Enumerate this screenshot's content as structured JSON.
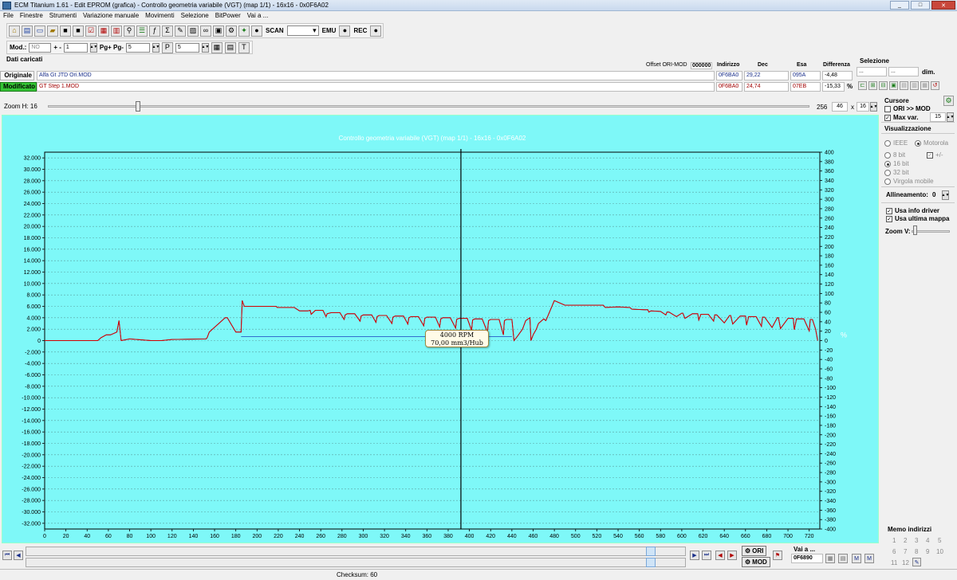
{
  "window": {
    "title": "ECM Titanium 1.61 - Edit EPROM (grafica) - Controllo geometria variabile (VGT) (map 1/1) - 16x16 - 0x0F6A02",
    "minimize": "_",
    "maximize": "□",
    "close": "✕"
  },
  "menu": [
    "File",
    "Finestre",
    "Strumenti",
    "Variazione manuale",
    "Movimenti",
    "Selezione",
    "BitPower",
    "Vai a ..."
  ],
  "toolbar": {
    "scan": "SCAN",
    "emu": "EMU",
    "rec": "REC",
    "sigma": "Σ"
  },
  "toolbar2": {
    "mod_label": "Mod.:",
    "mod_value": "NO",
    "plusminus_label": "+ -",
    "plusminus_value": "1",
    "pg_label": "Pg+ Pg-",
    "pg_value": "5",
    "p_value": "5"
  },
  "data_section": {
    "heading": "Dati caricati",
    "offset_label": "Offset ORI-MOD",
    "offset_value": "000000",
    "col_indirizzo": "Indirizzo",
    "col_dec": "Dec",
    "col_esa": "Esa",
    "col_diff": "Differenza",
    "selezione": "Selezione",
    "sel_from": "...",
    "sel_to": "...",
    "sel_dim_label": "dim.",
    "sel_dim_value": "...",
    "originale": {
      "tag": "Originale",
      "file": "Alfa Gt JTD Ori.MOD",
      "indirizzo": "0F6BA0",
      "dec": "29,22",
      "esa": "095A",
      "diff": "-4,48"
    },
    "modificato": {
      "tag": "Modificato",
      "file": "GT Step 1.MOD",
      "indirizzo": "0F6BA0",
      "dec": "24,74",
      "esa": "07EB",
      "diff": "-15,33",
      "pct": "%"
    }
  },
  "zoom": {
    "label": "Zoom H: 16",
    "v1": "256",
    "v2": "46",
    "x": "x",
    "v3": "16"
  },
  "cursor_tip": {
    "line1": "4000 RPM",
    "line2": "70,00 mm3/Hub"
  },
  "chart_data": {
    "type": "line",
    "title": "Controllo geometria variabile (VGT) (map 1/1) - 16x16 - 0x0F6A02",
    "xlabel": "",
    "ylabel": "",
    "y2label": "%",
    "xlim": [
      0,
      730
    ],
    "ylim": [
      -33000,
      33000
    ],
    "y2lim": [
      -400,
      400
    ],
    "xticks": [
      0,
      20,
      40,
      60,
      80,
      100,
      120,
      140,
      160,
      180,
      200,
      220,
      240,
      260,
      280,
      300,
      320,
      340,
      360,
      380,
      400,
      420,
      440,
      460,
      480,
      500,
      520,
      540,
      560,
      580,
      600,
      620,
      640,
      660,
      680,
      700,
      720
    ],
    "yticks": [
      32000,
      30000,
      28000,
      26000,
      24000,
      22000,
      20000,
      18000,
      16000,
      14000,
      12000,
      10000,
      8000,
      6000,
      4000,
      2000,
      0,
      -2000,
      -4000,
      -6000,
      -8000,
      -10000,
      -12000,
      -14000,
      -16000,
      -18000,
      -20000,
      -22000,
      -24000,
      -26000,
      -28000,
      -30000,
      -32000
    ],
    "yticklabels": [
      "32.000",
      "30.000",
      "28.000",
      "26.000",
      "24.000",
      "22.000",
      "20.000",
      "18.000",
      "16.000",
      "14.000",
      "12.000",
      "10.000",
      "8.000",
      "6.000",
      "4.000",
      "2.000",
      "0",
      "-2.000",
      "-4.000",
      "-6.000",
      "-8.000",
      "-10.000",
      "-12.000",
      "-14.000",
      "-16.000",
      "-18.000",
      "-20.000",
      "-22.000",
      "-24.000",
      "-26.000",
      "-28.000",
      "-30.000",
      "-32.000"
    ],
    "y2ticks": [
      400,
      380,
      360,
      340,
      320,
      300,
      280,
      260,
      240,
      220,
      200,
      180,
      160,
      140,
      120,
      100,
      80,
      60,
      40,
      20,
      0,
      -20,
      -40,
      -60,
      -80,
      -100,
      -120,
      -140,
      -160,
      -180,
      -200,
      -220,
      -240,
      -260,
      -280,
      -300,
      -320,
      -340,
      -360,
      -380,
      -400
    ],
    "cursor_x": 392,
    "grid": true,
    "series": [
      {
        "color": "#d40000",
        "x": [
          0,
          50,
          53,
          58,
          60,
          62,
          68,
          70,
          72,
          80,
          100,
          110,
          120,
          152,
          153,
          155,
          170,
          172,
          180,
          185,
          186,
          188,
          200,
          210,
          215,
          218,
          219,
          220,
          235,
          240,
          248,
          250,
          251,
          255,
          262,
          265,
          266,
          270,
          278,
          282,
          283,
          285,
          292,
          297,
          298,
          300,
          308,
          312,
          313,
          315,
          322,
          327,
          328,
          330,
          338,
          342,
          343,
          345,
          352,
          357,
          358,
          360,
          368,
          372,
          373,
          375,
          382,
          387,
          388,
          390,
          398,
          402,
          403,
          405,
          412,
          417,
          418,
          420,
          428,
          432,
          433,
          435,
          437,
          440,
          442,
          445,
          450,
          453,
          457,
          458,
          460,
          463,
          465,
          470,
          472,
          480,
          490,
          500,
          510,
          520,
          525,
          526,
          528,
          540,
          550,
          551,
          553,
          565,
          568,
          569,
          571,
          580,
          585,
          586,
          588,
          595,
          600,
          601,
          603,
          610,
          615,
          616,
          618,
          625,
          630,
          631,
          633,
          640,
          645,
          646,
          648,
          655,
          660,
          661,
          663,
          670,
          675,
          676,
          678,
          685,
          690,
          691,
          693,
          700,
          705,
          706,
          708,
          715,
          720,
          721,
          723,
          726,
          728
        ],
        "y": [
          0,
          0,
          500,
          1000,
          1000,
          1000,
          1500,
          3500,
          0,
          300,
          0,
          0,
          200,
          300,
          500,
          1500,
          4000,
          4000,
          1500,
          1500,
          7000,
          6000,
          6000,
          6000,
          6000,
          6000,
          5800,
          5800,
          5800,
          5200,
          5200,
          5300,
          4600,
          5300,
          5300,
          4200,
          4700,
          4900,
          4900,
          3700,
          4500,
          4700,
          4700,
          3400,
          4300,
          4500,
          4500,
          3200,
          4200,
          4400,
          4400,
          3000,
          4100,
          4300,
          4300,
          2900,
          4000,
          4200,
          4200,
          2600,
          3900,
          4100,
          4100,
          2400,
          3800,
          4000,
          4000,
          2200,
          3700,
          3900,
          3900,
          1800,
          3600,
          3800,
          3800,
          1500,
          3500,
          3700,
          3700,
          1000,
          3500,
          3700,
          3700,
          3700,
          0,
          700,
          2000,
          3500,
          4000,
          0,
          1000,
          2000,
          3000,
          3800,
          3500,
          7000,
          6200,
          6200,
          6200,
          6200,
          6200,
          6200,
          5800,
          5900,
          5800,
          5800,
          5500,
          5400,
          5400,
          5000,
          5200,
          5100,
          4500,
          5000,
          5000,
          4200,
          4800,
          4800,
          3900,
          4700,
          4700,
          3600,
          4600,
          4600,
          3400,
          4500,
          4500,
          3100,
          4400,
          4400,
          2900,
          4300,
          4300,
          2700,
          4200,
          4200,
          2500,
          4100,
          4100,
          2300,
          4000,
          4000,
          2100,
          3900,
          3900,
          1900,
          3800,
          3800,
          1700,
          3700,
          3700,
          2000,
          0
        ]
      },
      {
        "color": "#1a40c0",
        "x": [
          0,
          50,
          53,
          58,
          60,
          62,
          68,
          70,
          72,
          80,
          100,
          110,
          120,
          152,
          153,
          155,
          170,
          172,
          180,
          185,
          186,
          188,
          200,
          210,
          215,
          218,
          219,
          220,
          235,
          240,
          248,
          250,
          251,
          255,
          262,
          265,
          266,
          270,
          278,
          282,
          283,
          285,
          292,
          297,
          298,
          300,
          308,
          312,
          313,
          315,
          322,
          327,
          328,
          330,
          338,
          342,
          343,
          345,
          352,
          357,
          358,
          360,
          368,
          372,
          373,
          375,
          382,
          387,
          388,
          390,
          398,
          402,
          403,
          405,
          412,
          417,
          418,
          420,
          428,
          432,
          433,
          435,
          437,
          440,
          442,
          445,
          450,
          453,
          457,
          458,
          460,
          463,
          465,
          470,
          472,
          480,
          490,
          500,
          510,
          520,
          525,
          526,
          528,
          540,
          550,
          551,
          553,
          565,
          568,
          569,
          571,
          580,
          585,
          586,
          588,
          595,
          600,
          601,
          603,
          610,
          615,
          616,
          618,
          625,
          630,
          631,
          633,
          640,
          645,
          646,
          648,
          655,
          660,
          661,
          663,
          670,
          675,
          676,
          678,
          685,
          690,
          691,
          693,
          700,
          705,
          706,
          708,
          715,
          720,
          721,
          723,
          726,
          728
        ],
        "y": [
          0,
          0,
          500,
          1000,
          1000,
          1000,
          1500,
          3500,
          0,
          300,
          0,
          0,
          200,
          300,
          500,
          1500,
          4000,
          4000,
          1500,
          1500,
          7000,
          6000,
          6000,
          6000,
          6000,
          6000,
          5800,
          5800,
          5800,
          5200,
          5200,
          5300,
          4600,
          5300,
          5300,
          4200,
          4700,
          4900,
          4900,
          3700,
          4500,
          4700,
          4700,
          3400,
          4300,
          4500,
          4500,
          3200,
          4200,
          4400,
          4400,
          3000,
          4100,
          4300,
          4300,
          2900,
          4000,
          4200,
          4200,
          2600,
          3900,
          4100,
          4100,
          2400,
          3800,
          4000,
          4000,
          2200,
          3700,
          3900,
          3900,
          1800,
          3600,
          3800,
          3800,
          1500,
          3500,
          3700,
          3700,
          1000,
          3500,
          3700,
          3700,
          3700,
          0,
          700,
          2000,
          3500,
          4000,
          0,
          1000,
          2000,
          3000,
          3800,
          3500,
          7000,
          6200,
          6200,
          6200,
          6200,
          6200,
          6200,
          5800,
          5900,
          5800,
          5800,
          5500,
          5400,
          5400,
          5000,
          5200,
          5100,
          4500,
          5000,
          5000,
          4200,
          4800,
          4800,
          3900,
          4700,
          4700,
          3600,
          4600,
          4600,
          3400,
          4500,
          4500,
          3100,
          4400,
          4400,
          2900,
          4300,
          4300,
          2700,
          4200,
          4200,
          2500,
          4100,
          4100,
          2300,
          4000,
          4000,
          2100,
          3900,
          3900,
          1900,
          3800,
          3800,
          1700,
          3700,
          3700,
          2000,
          0
        ]
      },
      {
        "color": "#1a40c0",
        "x": [
          185,
          440
        ],
        "y": [
          700,
          700
        ]
      }
    ]
  },
  "side": {
    "cursore_title": "Cursore",
    "ori_mod": "ORI >> MOD",
    "max_var": "Max var.",
    "max_var_value": "15",
    "visual_title": "Visualizzazione",
    "ieee": "IEEE",
    "motorola": "Motorola",
    "b8": "8 bit",
    "plusminus": "+/-",
    "b16": "16 bit",
    "b32": "32 bit",
    "virgola": "Virgola mobile",
    "allineamento": "Allineamento:",
    "allineamento_value": "0",
    "usa_info": "Usa info driver",
    "usa_ultima": "Usa ultima mappa",
    "zoom_v": "Zoom V:"
  },
  "bottom": {
    "ori_btn": "ORI",
    "mod_btn": "MOD",
    "vai_label": "Vai a ...",
    "vai_value": "0F6890",
    "memo_title": "Memo indirizzi",
    "memo": [
      "1",
      "2",
      "3",
      "4",
      "5",
      "6",
      "7",
      "8",
      "9",
      "10",
      "11",
      "12"
    ],
    "checksum": "Checksum: 60"
  }
}
